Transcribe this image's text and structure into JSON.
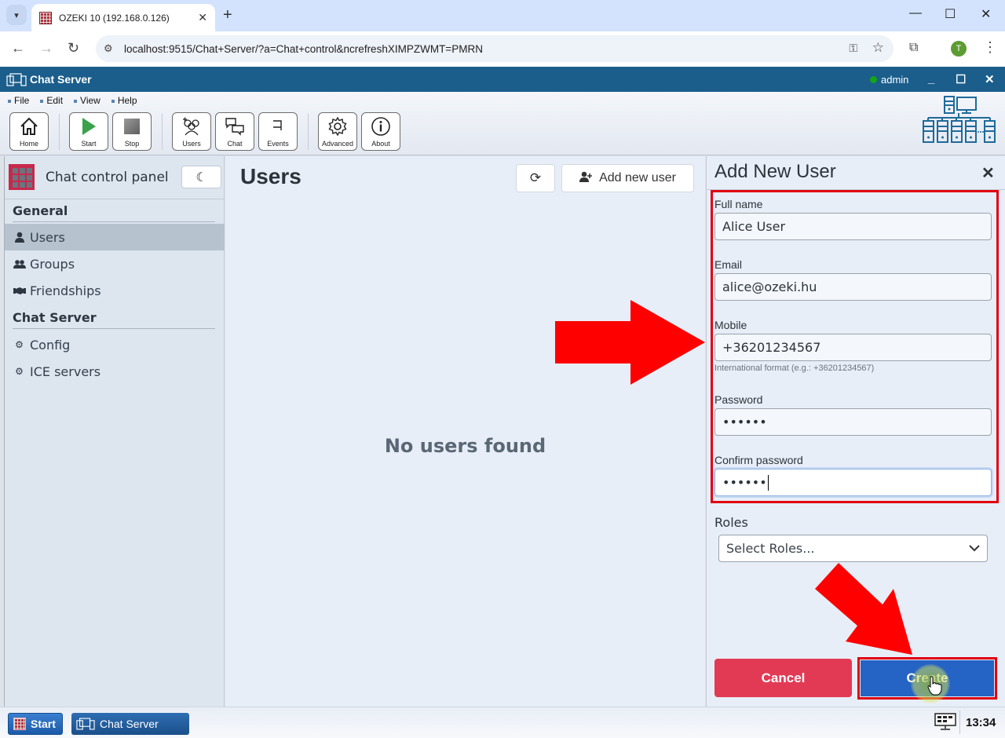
{
  "browser": {
    "tab_title": "OZEKI 10 (192.168.0.126)",
    "url": "localhost:9515/Chat+Server/?a=Chat+control&ncrefreshXIMPZWMT=PMRN",
    "profile_initial": "T"
  },
  "app": {
    "title": "Chat Server",
    "user": "admin",
    "status_color": "#17a317"
  },
  "menu": [
    "File",
    "Edit",
    "View",
    "Help"
  ],
  "toolbar": {
    "home": "Home",
    "start": "Start",
    "stop": "Stop",
    "users": "Users",
    "chat": "Chat",
    "events": "Events",
    "advanced": "Advanced",
    "about": "About"
  },
  "sidebar": {
    "title": "Chat control panel",
    "sections": [
      {
        "label": "General",
        "items": [
          {
            "label": "Users",
            "icon": "user-icon",
            "active": true
          },
          {
            "label": "Groups",
            "icon": "users-icon",
            "active": false
          },
          {
            "label": "Friendships",
            "icon": "handshake-icon",
            "active": false
          }
        ]
      },
      {
        "label": "Chat Server",
        "items": [
          {
            "label": "Config",
            "icon": "gears-icon",
            "active": false
          },
          {
            "label": "ICE servers",
            "icon": "gears-icon",
            "active": false
          }
        ]
      }
    ]
  },
  "main": {
    "title": "Users",
    "add_user_label": "Add new user",
    "empty_message": "No users found"
  },
  "form": {
    "title": "Add New User",
    "fields": {
      "full_name": {
        "label": "Full name",
        "value": "Alice User"
      },
      "email": {
        "label": "Email",
        "value": "alice@ozeki.hu"
      },
      "mobile": {
        "label": "Mobile",
        "value": "+36201234567",
        "hint": "International format (e.g.: +36201234567)"
      },
      "password": {
        "label": "Password",
        "value": "••••••"
      },
      "confirm_password": {
        "label": "Confirm password",
        "value": "••••••"
      }
    },
    "roles_label": "Roles",
    "roles_placeholder": "Select Roles...",
    "cancel_label": "Cancel",
    "create_label": "Create",
    "cancel_color": "#e23a55",
    "create_color": "#2563c4",
    "annotation_color": "#ff0000"
  },
  "taskbar": {
    "start_label": "Start",
    "app_label": "Chat Server",
    "clock": "13:34"
  }
}
